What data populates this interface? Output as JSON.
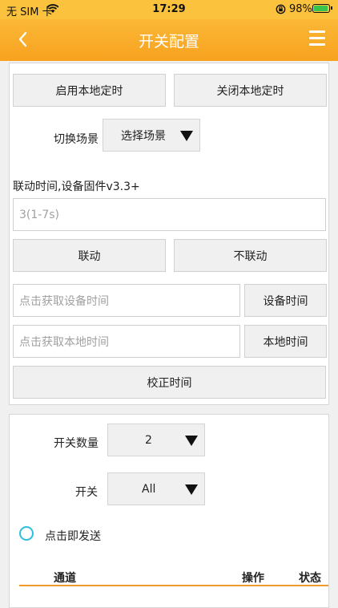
{
  "status_bar": {
    "carrier": "无 SIM 卡",
    "time": "17:29",
    "battery": "98%",
    "battery_level": 0.98,
    "icons": [
      "wifi-icon",
      "orientation-lock-icon",
      "battery-charging-icon"
    ]
  },
  "nav": {
    "title": "开关配置",
    "back_icon": "chevron-left-icon",
    "menu_icon": "hamburger-menu-icon"
  },
  "timer": {
    "enable_label": "启用本地定时",
    "disable_label": "关闭本地定时"
  },
  "scene": {
    "label": "切换场景",
    "selected": "选择场景"
  },
  "linkage": {
    "label": "联动时间,设备固件v3.3+",
    "input_placeholder": "3(1-7s)",
    "link_label": "联动",
    "unlink_label": "不联动"
  },
  "time_sync": {
    "device_placeholder": "点击获取设备时间",
    "device_button": "设备时间",
    "local_placeholder": "点击获取本地时间",
    "local_button": "本地时间",
    "calibrate_label": "校正时间"
  },
  "switch_config": {
    "count_label": "开关数量",
    "count_value": "2",
    "switch_label": "开关",
    "switch_value": "All",
    "send_on_click_label": "点击即发送",
    "table_headers": [
      "通道",
      "操作",
      "状态"
    ]
  },
  "colors": {
    "accent": "#f7a21f",
    "radio": "#2dc0de",
    "header_line": "#f29a2e"
  }
}
